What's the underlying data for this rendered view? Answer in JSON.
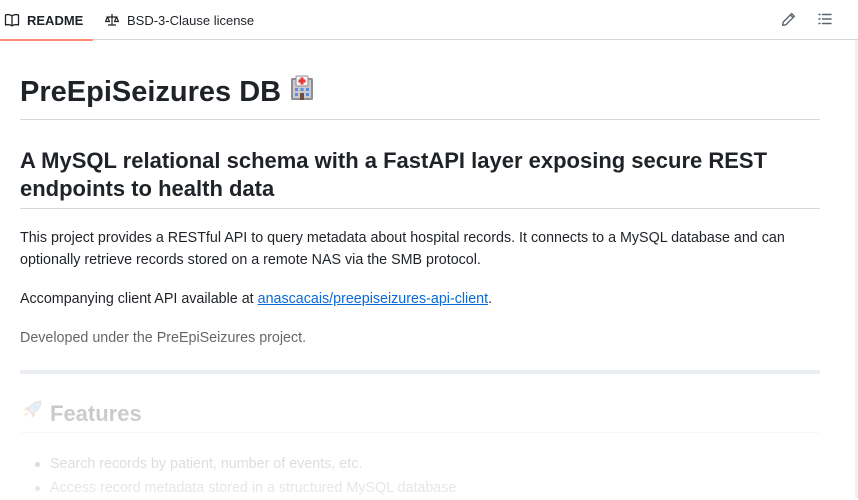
{
  "tabs": {
    "readme_label": "README",
    "license_label": "BSD-3-Clause license"
  },
  "icons": {
    "readme": "book-icon",
    "license": "law-icon",
    "edit": "pencil-icon",
    "toc": "list-icon",
    "hospital": "hospital-emoji",
    "rocket": "rocket-emoji"
  },
  "readme": {
    "title": "PreEpiSeizures DB",
    "subtitle": "A MySQL relational schema with a FastAPI layer exposing secure REST endpoints to health data",
    "intro": "This project provides a RESTful API to query metadata about hospital records. It connects to a MySQL database and can optionally retrieve records stored on a remote NAS via the SMB protocol.",
    "client_prefix": "Accompanying client API available at ",
    "client_link": "anascacais/preepiseizures-api-client",
    "client_suffix": ".",
    "developed": "Developed under the PreEpiSeizures project.",
    "features_heading": "Features",
    "features": [
      "Search records by patient, number of events, etc.",
      "Access record metadata stored in a structured MySQL database"
    ]
  },
  "colors": {
    "accent_underline": "#fd8c73",
    "link": "#0969da",
    "text": "#1f2328",
    "border": "#d1d9e0"
  }
}
